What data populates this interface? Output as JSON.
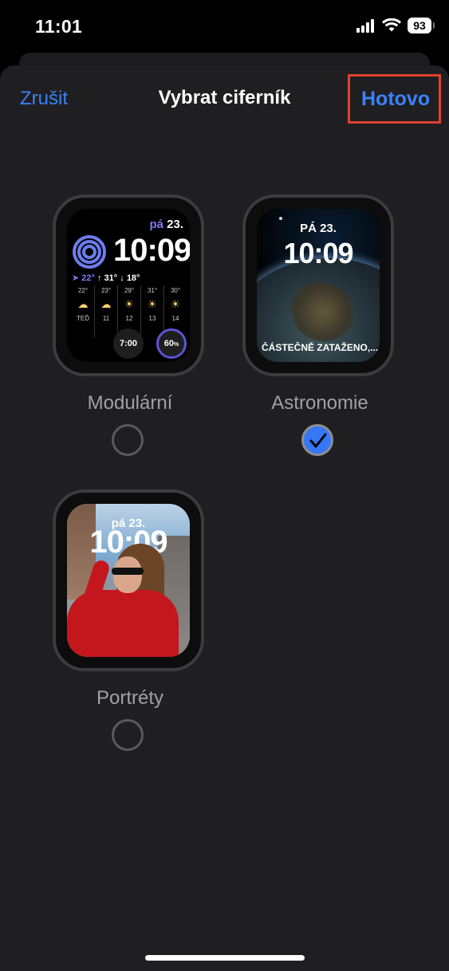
{
  "status_bar": {
    "time": "11:01",
    "battery": "93"
  },
  "nav": {
    "cancel": "Zrušit",
    "title": "Vybrat ciferník",
    "done": "Hotovo"
  },
  "faces": [
    {
      "label": "Modulární",
      "selected": false,
      "preview": {
        "day": "pá",
        "date": "23.",
        "time": "10:09",
        "weather_header": {
          "loc_temp": "22°",
          "high": "31°",
          "low": "18°"
        },
        "forecast": [
          {
            "temp": "22°",
            "hour": "TEĎ"
          },
          {
            "temp": "23°",
            "hour": "11"
          },
          {
            "temp": "29°",
            "hour": "12"
          },
          {
            "temp": "31°",
            "hour": "13"
          },
          {
            "temp": "30°",
            "hour": "14"
          }
        ],
        "complication_time": "7:00",
        "complication_rain": "60",
        "complication_rain_unit": "%"
      }
    },
    {
      "label": "Astronomie",
      "selected": true,
      "preview": {
        "date": "PÁ 23.",
        "time": "10:09",
        "weather": "ČÁSTEČNĚ ZATAŽENO,..."
      }
    },
    {
      "label": "Portréty",
      "selected": false,
      "preview": {
        "date": "pá 23.",
        "time": "10:09"
      }
    }
  ],
  "colors": {
    "accent": "#3a82f7",
    "highlight_box": "#e2412d",
    "sheet": "#1f1f21"
  }
}
